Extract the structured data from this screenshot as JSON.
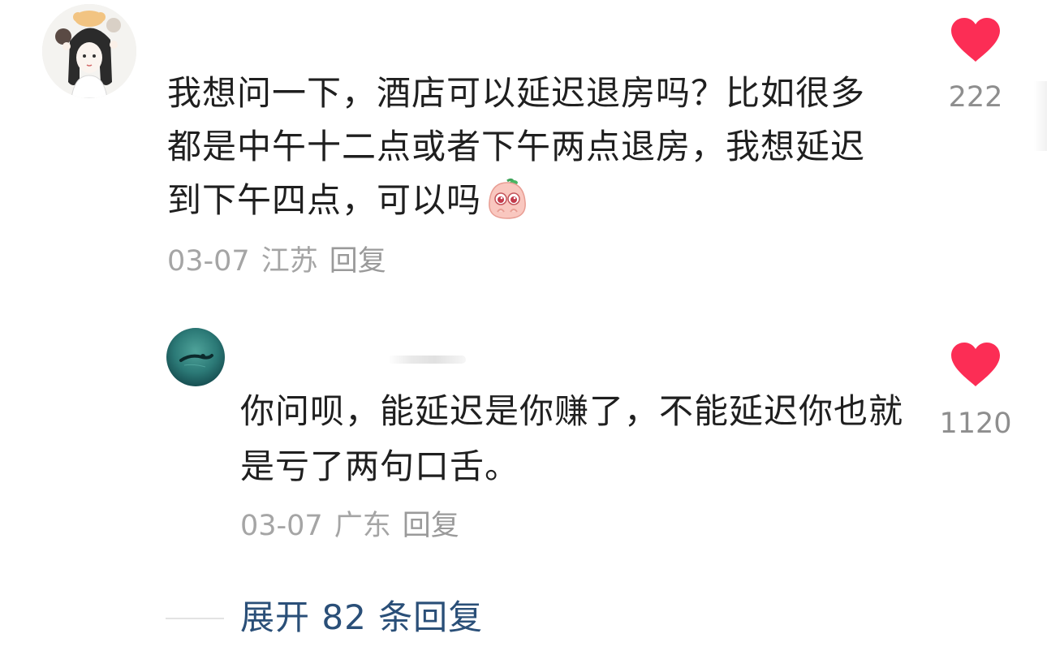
{
  "main_comment": {
    "text": "我想问一下，酒店可以延迟退房吗？比如很多都是中午十二点或者下午两点退房，我想延迟到下午四点，可以吗",
    "emoji_icon": "pleading-face-icon",
    "date": "03-07",
    "location": "江苏",
    "reply_label": "回复",
    "likes": "222"
  },
  "reply_comment": {
    "text": "你问呗，能延迟是你赚了，不能延迟你也就是亏了两句口舌。",
    "date": "03-07",
    "location": "广东",
    "reply_label": "回复",
    "likes": "1120"
  },
  "expand": {
    "label": "展开 82 条回复"
  },
  "colors": {
    "heart": "#fc2d55",
    "text": "#1f1f1f",
    "meta": "#a5a5a5",
    "expand": "#2a4f78"
  }
}
